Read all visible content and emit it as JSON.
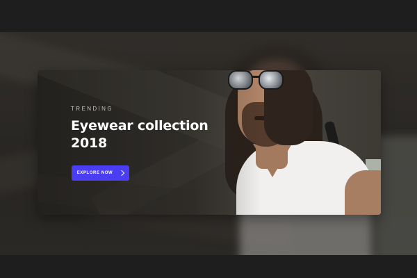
{
  "hero": {
    "eyebrow": "TRENDING",
    "title": "Eyewear collection 2018",
    "cta_label": "EXPLORE NOW",
    "cta_icon": "chevron-right-icon"
  },
  "colors": {
    "page_bg": "#1e1e1e",
    "accent": "#4a3df2",
    "title_text": "#ffffff",
    "eyebrow_text": "#c9c6c1"
  }
}
